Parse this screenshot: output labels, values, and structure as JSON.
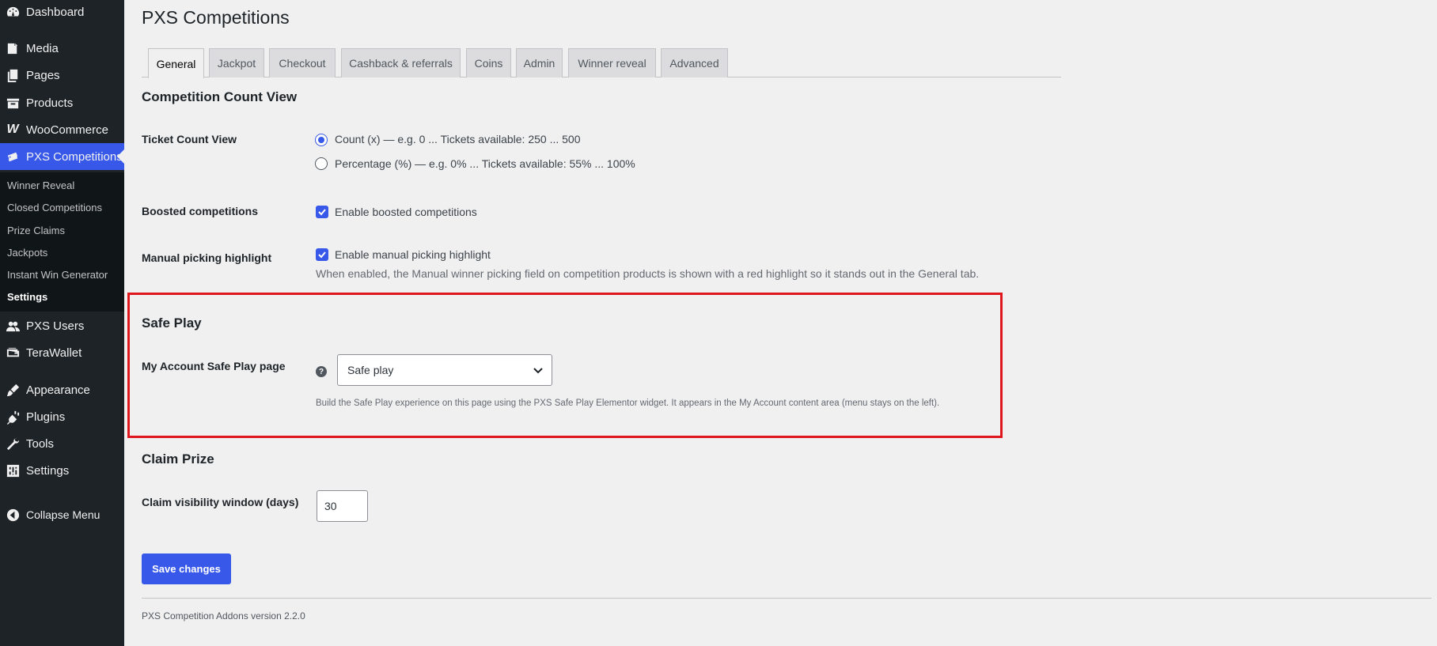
{
  "sidebar": {
    "items": [
      {
        "label": "Dashboard",
        "icon": "dashboard-icon"
      },
      {
        "label": "Media",
        "icon": "media-icon"
      },
      {
        "label": "Pages",
        "icon": "pages-icon"
      },
      {
        "label": "Products",
        "icon": "products-icon"
      },
      {
        "label": "WooCommerce",
        "icon": "woocommerce-icon"
      },
      {
        "label": "PXS Competitions",
        "icon": "tickets-icon"
      },
      {
        "label": "PXS Users",
        "icon": "users-icon"
      },
      {
        "label": "TeraWallet",
        "icon": "wallet-icon"
      },
      {
        "label": "Appearance",
        "icon": "brush-icon"
      },
      {
        "label": "Plugins",
        "icon": "plugin-icon"
      },
      {
        "label": "Tools",
        "icon": "wrench-icon"
      },
      {
        "label": "Settings",
        "icon": "settings-icon"
      },
      {
        "label": "Collapse Menu",
        "icon": "collapse-icon"
      }
    ],
    "submenu": [
      "Winner Reveal",
      "Closed Competitions",
      "Prize Claims",
      "Jackpots",
      "Instant Win Generator",
      "Settings"
    ]
  },
  "header": {
    "title": "PXS Competitions"
  },
  "tabs": [
    "General",
    "Jackpot",
    "Checkout",
    "Cashback & referrals",
    "Coins",
    "Admin",
    "Winner reveal",
    "Advanced"
  ],
  "count_view": {
    "section_title": "Competition Count View",
    "label": "Ticket Count View",
    "option_count": "Count (x) — e.g. 0 ... Tickets available: 250 ... 500",
    "option_percentage": "Percentage (%) — e.g. 0% ... Tickets available: 55% ... 100%",
    "selected": "count"
  },
  "boosted": {
    "label": "Boosted competitions",
    "checkbox_label": "Enable boosted competitions",
    "checked": true
  },
  "manual_picking": {
    "label": "Manual picking highlight",
    "checkbox_label": "Enable manual picking highlight",
    "checked": true,
    "description": "When enabled, the Manual winner picking field on competition products is shown with a red highlight so it stands out in the General tab."
  },
  "safe_play": {
    "section_title": "Safe Play",
    "label": "My Account Safe Play page",
    "help": "?",
    "selected_value": "Safe play",
    "description": "Build the Safe Play experience on this page using the PXS Safe Play Elementor widget. It appears in the My Account content area (menu stays on the left)."
  },
  "claim_prize": {
    "section_title": "Claim Prize",
    "label": "Claim visibility window (days)",
    "value": "30"
  },
  "save_label": "Save changes",
  "footer": "PXS Competition Addons version 2.2.0",
  "colors": {
    "accent": "#3858e9",
    "sidebar": "#1d2327",
    "highlight": "#e0161e"
  }
}
